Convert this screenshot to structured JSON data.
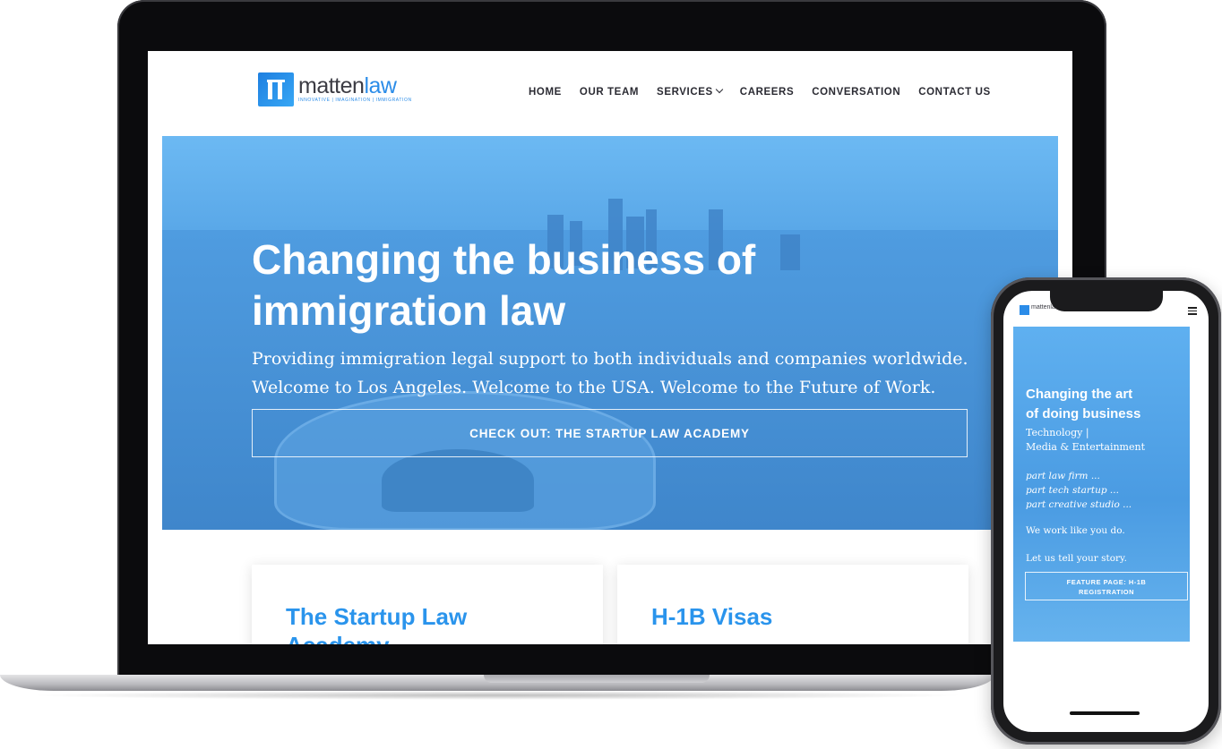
{
  "laptop": {
    "header": {
      "logo": {
        "name_part1": "matten",
        "name_part2": "law",
        "tagline": "INNOVATIVE | IMAGINATION | IMMIGRATION"
      },
      "nav": [
        "HOME",
        "OUR TEAM",
        "SERVICES",
        "CAREERS",
        "CONVERSATION",
        "CONTACT US"
      ]
    },
    "hero": {
      "title_line1": "Changing the business of",
      "title_line2": "immigration law",
      "subtitle_line1": "Providing immigration legal support to both individuals and companies worldwide.",
      "subtitle_line2": "Welcome to Los Angeles. Welcome to the USA. Welcome to the Future of Work.",
      "cta": "CHECK OUT: THE STARTUP LAW ACADEMY"
    },
    "cards": [
      "The Startup Law Academy",
      "H-1B Visas"
    ]
  },
  "phone": {
    "logo": "mattenlaw",
    "hero": {
      "title_line1": "Changing the art",
      "title_line2": "of doing business",
      "sub_line1": "Technology |",
      "sub_line2": "Media & Entertainment",
      "italic_line1": "part law firm ...",
      "italic_line2": "part tech startup ...",
      "italic_line3": "part creative studio ...",
      "work": "We work like you do.",
      "story": "Let us tell your story.",
      "cta_line1": "FEATURE PAGE: H-1B",
      "cta_line2": "REGISTRATION"
    }
  },
  "colors": {
    "accent": "#2b8ce8",
    "hero_blue": "#4a92d6"
  }
}
